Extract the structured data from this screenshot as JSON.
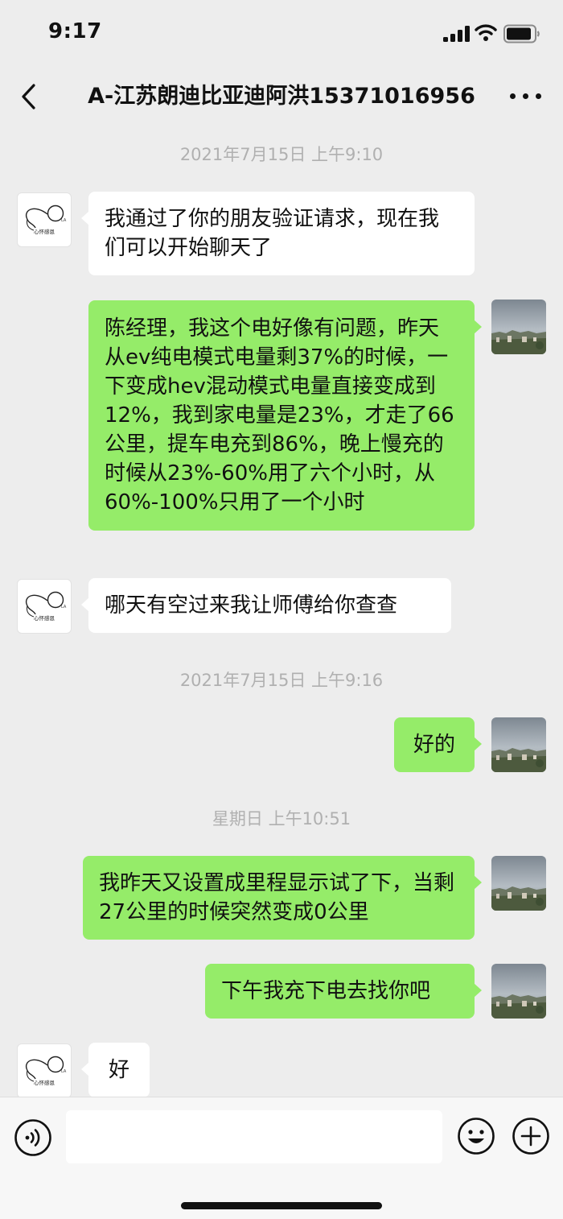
{
  "status_bar": {
    "time": "9:17"
  },
  "header": {
    "title": "A-江苏朗迪比亚迪阿洪15371016956"
  },
  "messages": {
    "ts1": "2021年7月15日 上午9:10",
    "m1": "我通过了你的朋友验证请求，现在我们可以开始聊天了",
    "m2": "陈经理，我这个电好像有问题，昨天从ev纯电模式电量剩37%的时候，一下变成hev混动模式电量直接变成到12%，我到家电量是23%，才走了66公里，提车电充到86%，晚上慢充的时候从23%-60%用了六个小时，从60%-100%只用了一个小时",
    "m3": "哪天有空过来我让师傅给你查查",
    "ts2": "2021年7月15日 上午9:16",
    "m4": "好的",
    "ts3": "星期日 上午10:51",
    "m5": "我昨天又设置成里程显示试了下，当剩27公里的时候突然变成0公里",
    "m6": "下午我充下电去找你吧",
    "m7": "好"
  },
  "avatar_other": {
    "caption": "心怀感恩"
  },
  "input_bar": {
    "value": "",
    "placeholder": ""
  },
  "icons": {
    "back": "chevron-left-icon",
    "more": "more-dots-icon",
    "voice": "voice-icon",
    "emoji": "emoji-icon",
    "plus": "plus-icon"
  },
  "colors": {
    "background": "#ededed",
    "self_bubble": "#95ec69",
    "other_bubble": "#ffffff",
    "timestamp": "#b0b0b0"
  }
}
